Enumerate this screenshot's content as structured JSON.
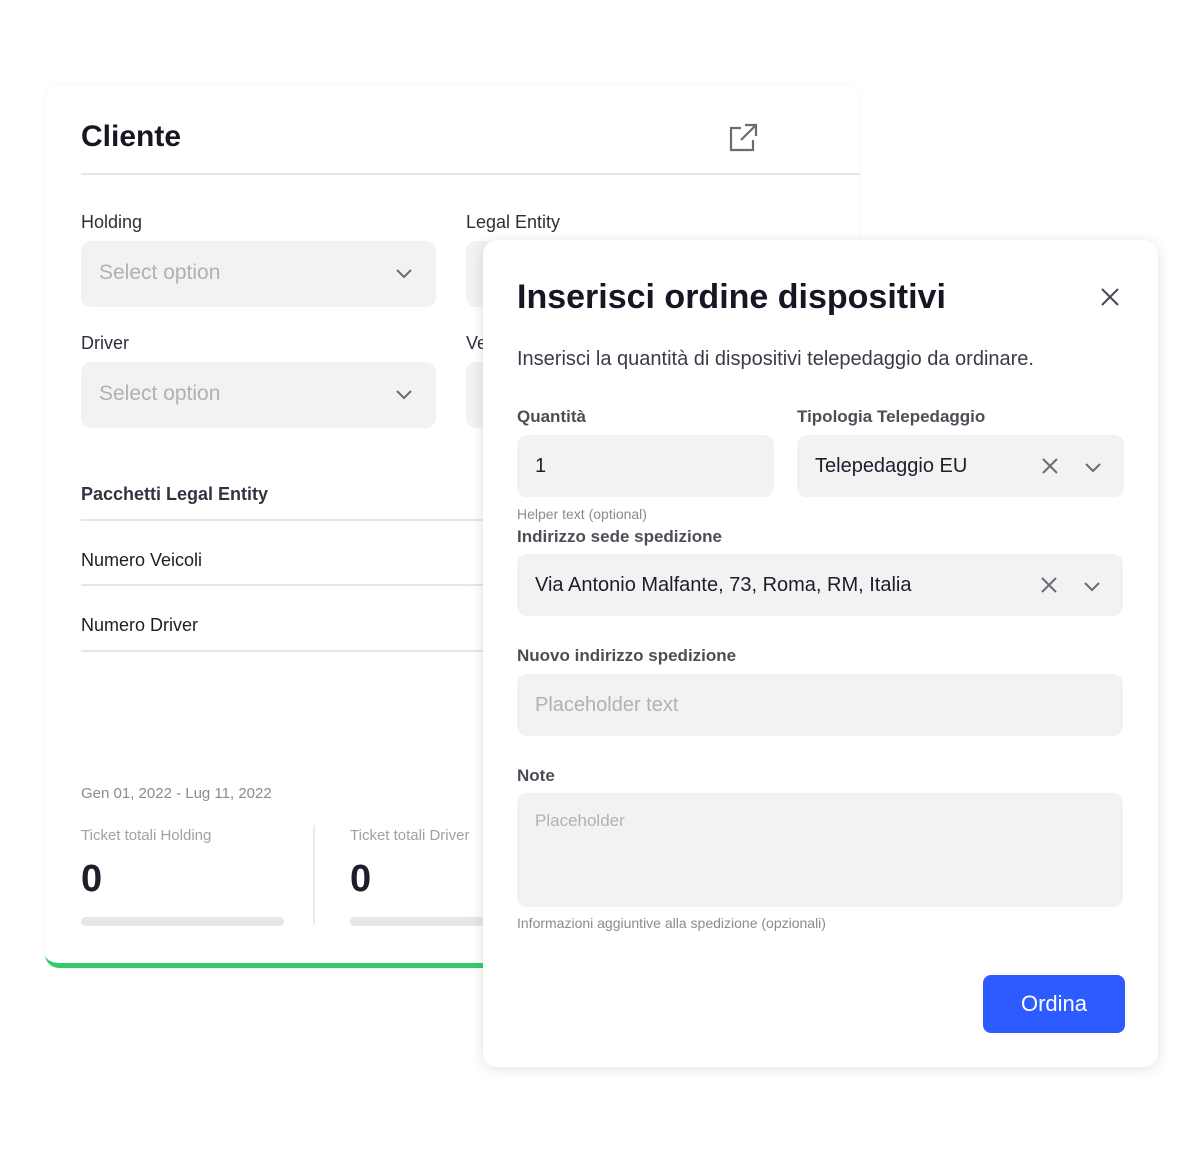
{
  "cliente": {
    "title": "Cliente",
    "holding_label": "Holding",
    "legal_entity_label": "Legal Entity",
    "driver_label": "Driver",
    "ve_label": "Ve",
    "select_placeholder": "Select option",
    "rows": [
      "Pacchetti Legal Entity",
      "Numero Veicoli",
      "Numero Driver"
    ],
    "date_range": "Gen 01, 2022 - Lug 11, 2022",
    "stats": [
      {
        "label": "Ticket totali Holding",
        "value": "0"
      },
      {
        "label": "Ticket totali Driver",
        "value": "0"
      }
    ],
    "accent": "#34cc6a"
  },
  "modal": {
    "title": "Inserisci ordine dispositivi",
    "description": "Inserisci la quantità di dispositivi telepedaggio da ordinare.",
    "quantita_label": "Quantità",
    "quantita_value": "1",
    "quantita_helper": "Helper text (optional)",
    "tipologia_label": "Tipologia Telepedaggio",
    "tipologia_value": "Telepedaggio EU",
    "indirizzo_label": "Indirizzo sede spedizione",
    "indirizzo_value": "Via Antonio Malfante, 73, Roma, RM, Italia",
    "nuovo_label": "Nuovo indirizzo spedizione",
    "nuovo_placeholder": "Placeholder text",
    "note_label": "Note",
    "note_placeholder": "Placeholder",
    "note_helper": "Informazioni aggiuntive alla spedizione (opzionali)",
    "submit": "Ordina",
    "button_color": "#2d5bff"
  }
}
